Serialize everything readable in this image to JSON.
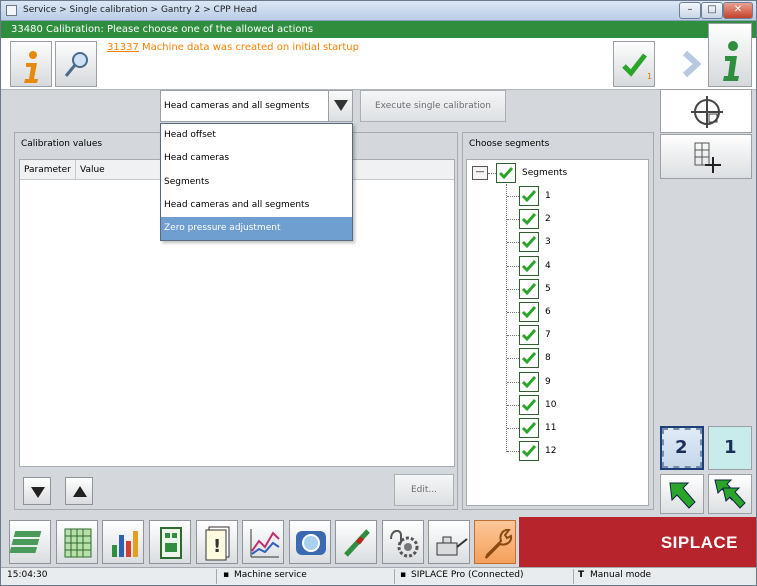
{
  "window": {
    "title": "Service > Single calibration > Gantry 2 > CPP Head"
  },
  "status": {
    "text": "33480 Calibration: Please choose one of the allowed actions",
    "color": "#2e8e3e"
  },
  "message": {
    "code": "31337",
    "text": "Machine data was created on initial startup",
    "color": "#ff7f00"
  },
  "toolbar_top": {
    "ok_badge": "1"
  },
  "calibration": {
    "selected": "Head cameras and all segments",
    "options": [
      "Head offset",
      "Head cameras",
      "Segments",
      "Head cameras and all segments",
      "Zero pressure adjustment"
    ],
    "highlighted_option": "Zero pressure adjustment",
    "execute_label": "Execute single calibration"
  },
  "values_panel": {
    "title": "Calibration values",
    "columns": [
      "Parameter",
      "Value"
    ],
    "edit_label": "Edit..."
  },
  "segments_panel": {
    "title": "Choose segments",
    "root_label": "Segments",
    "collapse_glyph": "—",
    "items": [
      "1",
      "2",
      "3",
      "4",
      "5",
      "6",
      "7",
      "8",
      "9",
      "10",
      "11",
      "12"
    ]
  },
  "gantry_buttons": {
    "two": "2",
    "one": "1"
  },
  "brand": {
    "name": "SIPLACE",
    "color": "#b8242b"
  },
  "footer": {
    "time": "15:04:30",
    "mode": "Machine service",
    "connection": "SIPLACE Pro (Connected)",
    "operation": "Manual mode"
  }
}
